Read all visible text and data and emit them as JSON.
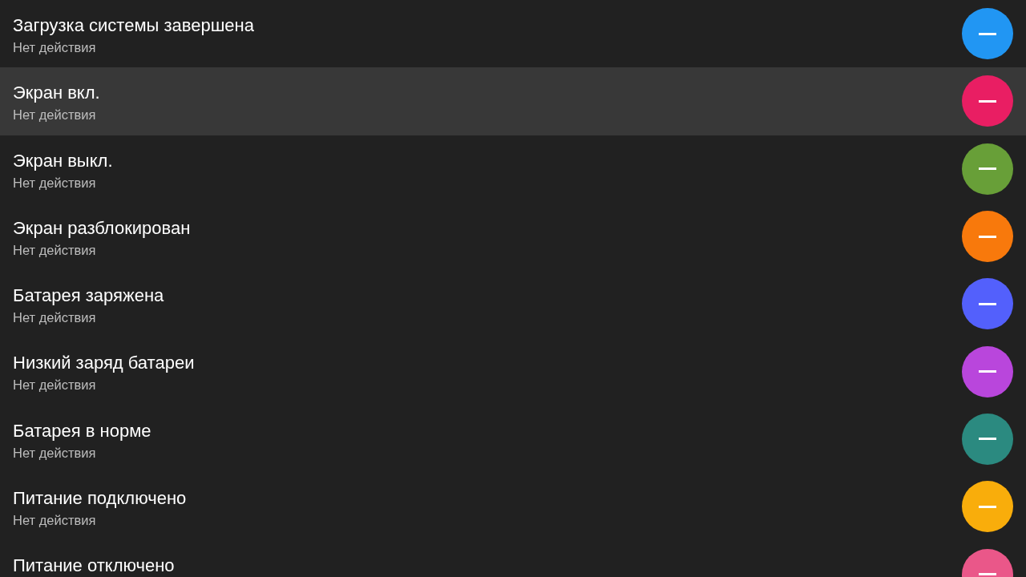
{
  "items": [
    {
      "title": "Загрузка системы завершена",
      "subtitle": "Нет действия",
      "color": "#2196f3",
      "selected": false
    },
    {
      "title": "Экран вкл.",
      "subtitle": "Нет действия",
      "color": "#e91e63",
      "selected": true
    },
    {
      "title": "Экран выкл.",
      "subtitle": "Нет действия",
      "color": "#689f38",
      "selected": false
    },
    {
      "title": "Экран разблокирован",
      "subtitle": "Нет действия",
      "color": "#f8790c",
      "selected": false
    },
    {
      "title": "Батарея заряжена",
      "subtitle": "Нет действия",
      "color": "#5360fc",
      "selected": false
    },
    {
      "title": "Низкий заряд батареи",
      "subtitle": "Нет действия",
      "color": "#b946dc",
      "selected": false
    },
    {
      "title": "Батарея в норме",
      "subtitle": "Нет действия",
      "color": "#2b8a80",
      "selected": false
    },
    {
      "title": "Питание подключено",
      "subtitle": "Нет действия",
      "color": "#f9ad0b",
      "selected": false
    },
    {
      "title": "Питание отключено",
      "color": "#ea5789",
      "selected": false
    }
  ]
}
